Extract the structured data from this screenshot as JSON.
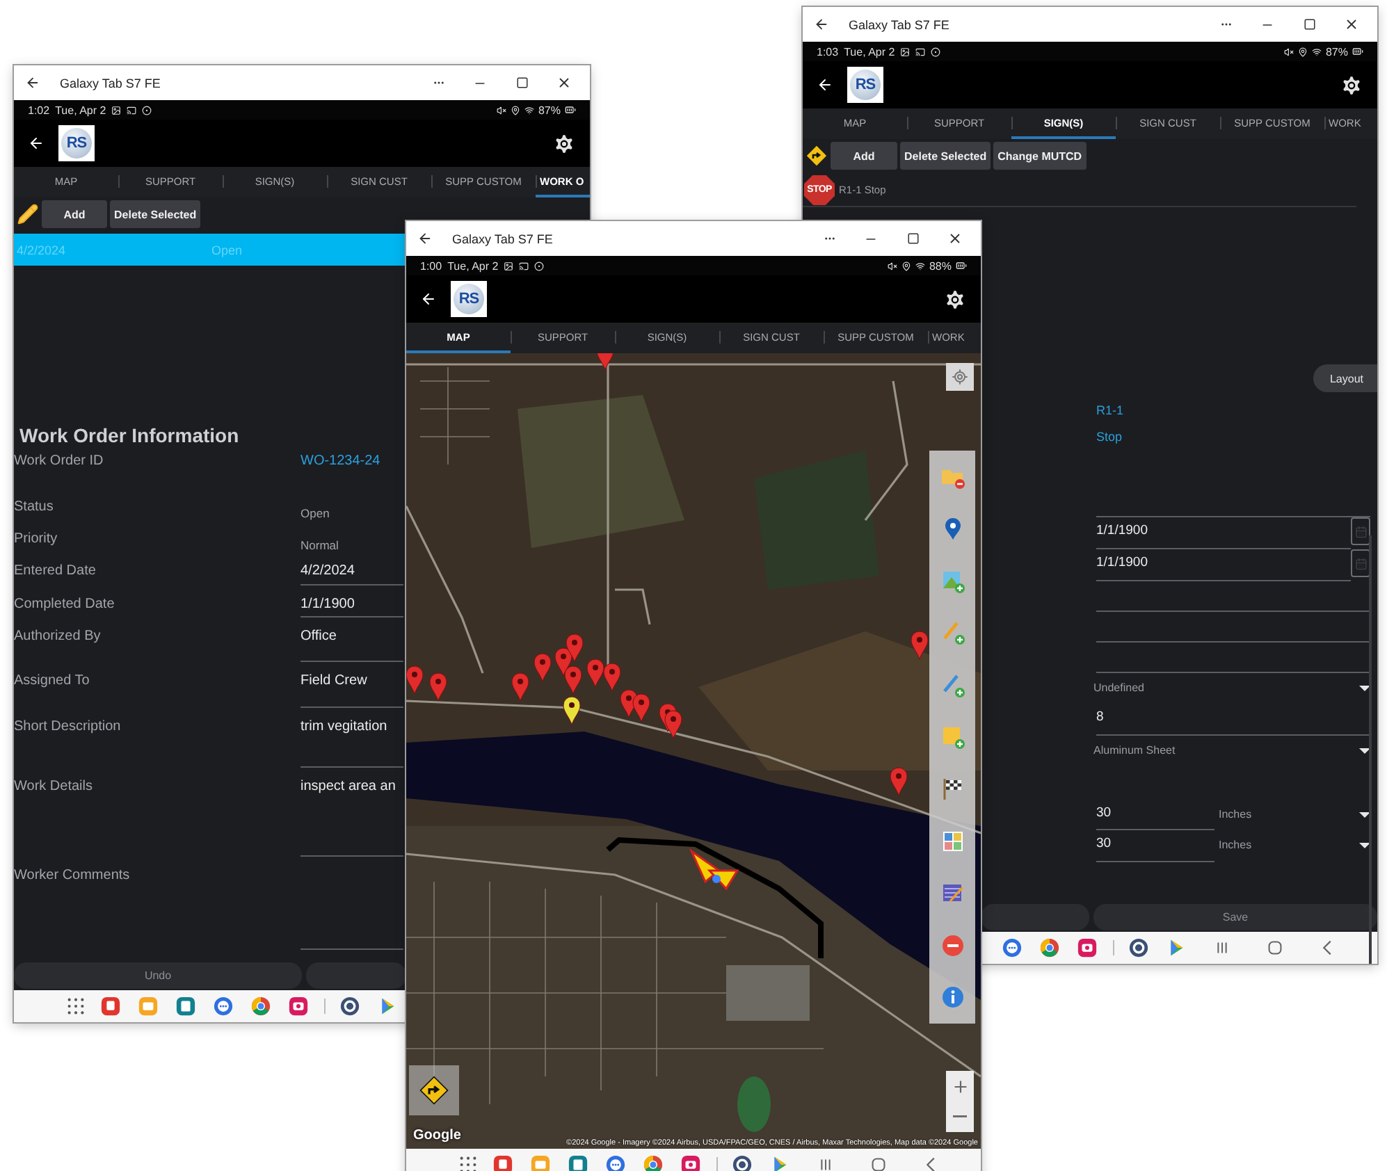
{
  "windows": [
    {
      "kind": "work_order",
      "title": "Galaxy Tab S7 FE",
      "status": {
        "time": "1:02",
        "date": "Tue, Apr 2",
        "battery": "87%"
      },
      "logo": "RS",
      "tabs": [
        {
          "label": "MAP",
          "selected": false
        },
        {
          "label": "SUPPORT",
          "selected": false
        },
        {
          "label": "SIGN(S)",
          "selected": false
        },
        {
          "label": "SIGN CUST",
          "selected": false
        },
        {
          "label": "SUPP CUSTOM",
          "selected": false
        },
        {
          "label": "WORK O",
          "selected": true
        }
      ],
      "toolbar": [
        "Add",
        "Delete Selected"
      ],
      "list_rows": [
        {
          "date": "4/2/2024",
          "status": "Open",
          "selected": true
        }
      ],
      "heading": "Work Order Information",
      "fields": [
        {
          "label": "Work Order ID",
          "kind": "link",
          "value": "WO-1234-24"
        },
        {
          "label": "Status",
          "kind": "choice",
          "value": "Open"
        },
        {
          "label": "Priority",
          "kind": "choice",
          "value": "Normal"
        },
        {
          "label": "Entered Date",
          "kind": "text",
          "value": "4/2/2024"
        },
        {
          "label": "Completed Date",
          "kind": "text",
          "value": "1/1/1900"
        },
        {
          "label": "Authorized By",
          "kind": "text",
          "value": "Office"
        },
        {
          "label": "Assigned To",
          "kind": "text",
          "value": "Field Crew"
        },
        {
          "label": "Short Description",
          "kind": "text",
          "value": "trim vegitation"
        },
        {
          "label": "Work Details",
          "kind": "text",
          "value": "inspect area an"
        },
        {
          "label": "Worker Comments",
          "kind": "text"
        }
      ],
      "buttons": [
        "Undo"
      ]
    },
    {
      "kind": "signs",
      "title": "Galaxy Tab S7 FE",
      "status": {
        "time": "1:03",
        "date": "Tue, Apr 2",
        "battery": "87%"
      },
      "logo": "RS",
      "tabs": [
        {
          "label": "MAP",
          "selected": false
        },
        {
          "label": "SUPPORT",
          "selected": false
        },
        {
          "label": "SIGN(S)",
          "selected": true
        },
        {
          "label": "SIGN CUST",
          "selected": false
        },
        {
          "label": "SUPP CUSTOM",
          "selected": false
        },
        {
          "label": "WORK",
          "selected": false
        }
      ],
      "toolbar": [
        "Add",
        "Delete Selected",
        "Change MUTCD"
      ],
      "signs": [
        {
          "icon_text": "STOP",
          "label": "R1-1 Stop"
        }
      ],
      "layout_button": "Layout",
      "fields": [
        {
          "kind": "link",
          "value": "R1-1"
        },
        {
          "kind": "link",
          "value": "Stop"
        },
        {
          "kind": "blank"
        },
        {
          "kind": "date",
          "value": "1/1/1900"
        },
        {
          "kind": "date",
          "value": "1/1/1900"
        },
        {
          "kind": "blank"
        },
        {
          "kind": "blank"
        },
        {
          "kind": "blank"
        },
        {
          "kind": "select",
          "value": "Undefined"
        },
        {
          "kind": "text",
          "value": "8"
        },
        {
          "kind": "select",
          "value": "Aluminum Sheet"
        },
        {
          "kind": "measure",
          "value": "30",
          "unit": "Inches"
        },
        {
          "kind": "measure",
          "value": "30",
          "unit": "Inches"
        }
      ],
      "buttons": [
        "Save"
      ]
    },
    {
      "kind": "map",
      "title": "Galaxy Tab S7 FE",
      "status": {
        "time": "1:00",
        "date": "Tue, Apr 2",
        "battery": "88%"
      },
      "logo": "RS",
      "tabs": [
        {
          "label": "MAP",
          "selected": true
        },
        {
          "label": "SUPPORT",
          "selected": false
        },
        {
          "label": "SIGN(S)",
          "selected": false
        },
        {
          "label": "SIGN CUST",
          "selected": false
        },
        {
          "label": "SUPP CUSTOM",
          "selected": false
        },
        {
          "label": "WORK",
          "selected": false
        }
      ],
      "map": {
        "logo": "Google",
        "attribution": "©2024 Google - Imagery ©2024 Airbus, USDA/FPAC/GEO, CNES / Airbus, Maxar Technologies, Map data ©2024 Google"
      }
    }
  ]
}
